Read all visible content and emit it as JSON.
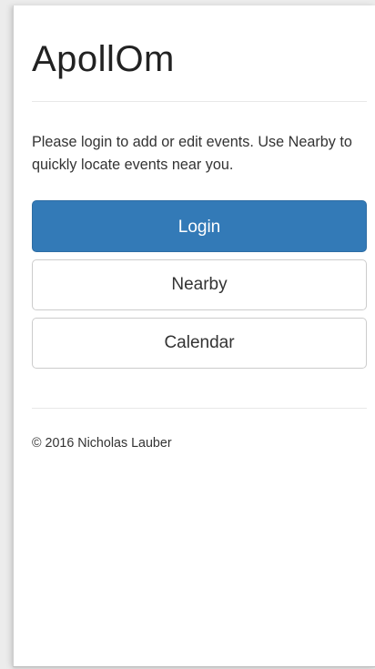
{
  "app": {
    "title": "ApollOm"
  },
  "intro": {
    "text": "Please login to add or edit events. Use Nearby to quickly locate events near you."
  },
  "actions": {
    "login_label": "Login",
    "nearby_label": "Nearby",
    "calendar_label": "Calendar"
  },
  "footer": {
    "copyright": "© 2016 Nicholas Lauber"
  },
  "colors": {
    "primary": "#337ab7",
    "primary_border": "#2e6da4",
    "default_border": "#cccccc",
    "text": "#333333"
  }
}
